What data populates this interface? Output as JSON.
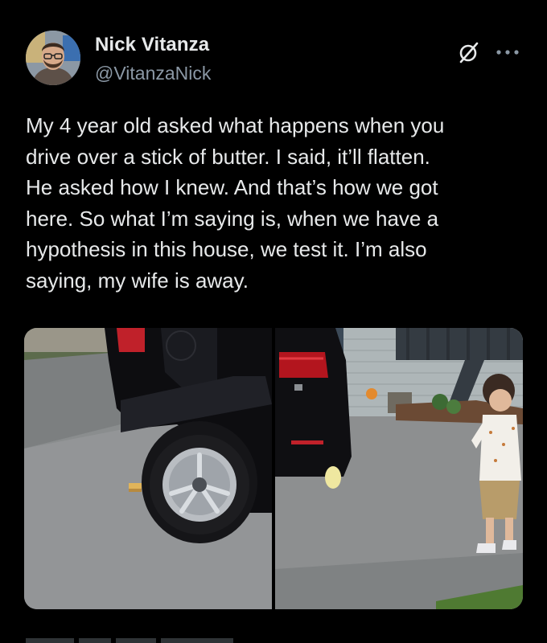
{
  "author": {
    "display_name": "Nick Vitanza",
    "handle": "@VitanzaNick",
    "avatar_alt": "Profile photo"
  },
  "actions": {
    "grok_icon": "grok-slash-icon",
    "more_icon": "more-horizontal-icon"
  },
  "tweet": {
    "text": "My 4 year old asked what happens when you\ndrive over a stick of butter. I said, it’ll flatten.\nHe asked how I knew. And that’s how we got\nhere. So what I’m saying is, when we have a\nhypothesis in this house, we test it. I’m also\nsaying, my wife is away."
  },
  "media": {
    "count": 2,
    "photos": [
      {
        "description_name": "car-tire-and-butter-photo"
      },
      {
        "description_name": "child-watching-car-photo"
      }
    ]
  },
  "colors": {
    "background": "#000000",
    "text_primary": "#e7e9ea",
    "text_secondary": "#8b98a5"
  }
}
